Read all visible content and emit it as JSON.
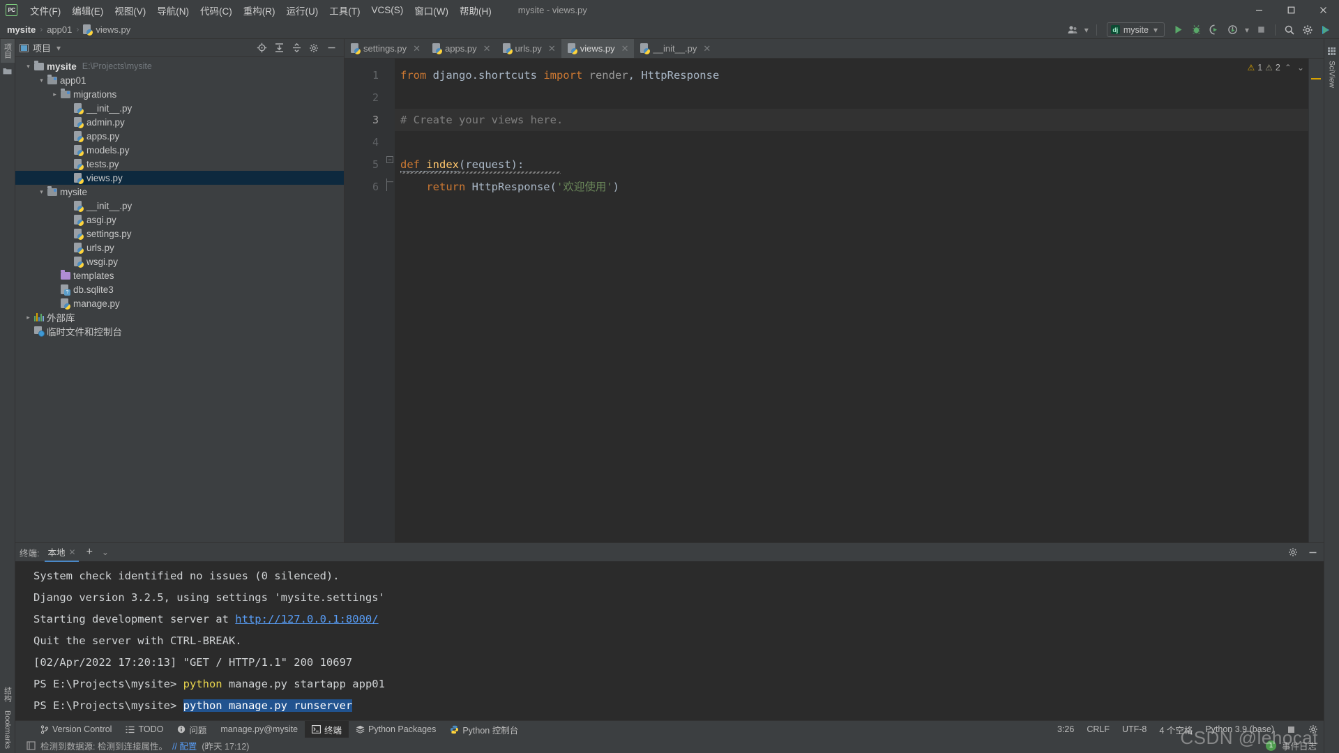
{
  "window": {
    "title": "mysite - views.py",
    "logo_text": "PC",
    "controls": {
      "minimize": "—",
      "maximize": "☐",
      "close": "✕"
    }
  },
  "menubar": {
    "items": [
      {
        "label": "文件(F)"
      },
      {
        "label": "编辑(E)"
      },
      {
        "label": "视图(V)"
      },
      {
        "label": "导航(N)"
      },
      {
        "label": "代码(C)"
      },
      {
        "label": "重构(R)"
      },
      {
        "label": "运行(U)"
      },
      {
        "label": "工具(T)"
      },
      {
        "label": "VCS(S)"
      },
      {
        "label": "窗口(W)"
      },
      {
        "label": "帮助(H)"
      }
    ]
  },
  "breadcrumb": {
    "items": [
      "mysite",
      "app01",
      "views.py"
    ],
    "separator": "›"
  },
  "toolbar": {
    "run_config": {
      "label": "mysite",
      "icon": "django-icon",
      "badge": "dj"
    },
    "buttons": [
      {
        "name": "user-icon",
        "glyph": "user"
      },
      {
        "name": "run-button",
        "glyph": "run"
      },
      {
        "name": "debug-button",
        "glyph": "debug"
      },
      {
        "name": "coverage-button",
        "glyph": "coverage"
      },
      {
        "name": "profile-button",
        "glyph": "profile"
      },
      {
        "name": "stop-button",
        "glyph": "stop"
      },
      {
        "name": "search-everywhere-button",
        "glyph": "search"
      },
      {
        "name": "settings-button",
        "glyph": "gear"
      },
      {
        "name": "update-button",
        "glyph": "play-colored"
      }
    ]
  },
  "rails": {
    "left_top": [
      {
        "label": "项目",
        "active": true
      }
    ],
    "left_bottom": [
      {
        "label": "结构"
      },
      {
        "label": "Bookmarks"
      }
    ],
    "right": [
      {
        "label": "SciView"
      }
    ]
  },
  "project_panel": {
    "title": "项目",
    "icons": [
      "locate-icon",
      "expand-all-icon",
      "collapse-all-icon",
      "gear-icon",
      "hide-icon"
    ],
    "tree": [
      {
        "label": "mysite",
        "path": "E:\\Projects\\mysite",
        "kind": "root-folder",
        "indent": 0,
        "arrow": "down",
        "bold": true
      },
      {
        "label": "app01",
        "kind": "source-folder",
        "indent": 1,
        "arrow": "down"
      },
      {
        "label": "migrations",
        "kind": "source-folder",
        "indent": 2,
        "arrow": "right"
      },
      {
        "label": "__init__.py",
        "kind": "python-file",
        "indent": 3
      },
      {
        "label": "admin.py",
        "kind": "python-file",
        "indent": 3
      },
      {
        "label": "apps.py",
        "kind": "python-file",
        "indent": 3
      },
      {
        "label": "models.py",
        "kind": "python-file",
        "indent": 3
      },
      {
        "label": "tests.py",
        "kind": "python-file",
        "indent": 3
      },
      {
        "label": "views.py",
        "kind": "python-file",
        "indent": 3,
        "selected": true
      },
      {
        "label": "mysite",
        "kind": "source-folder",
        "indent": 1,
        "arrow": "down"
      },
      {
        "label": "__init__.py",
        "kind": "python-file",
        "indent": 3
      },
      {
        "label": "asgi.py",
        "kind": "python-file",
        "indent": 3
      },
      {
        "label": "settings.py",
        "kind": "python-file",
        "indent": 3
      },
      {
        "label": "urls.py",
        "kind": "python-file",
        "indent": 3
      },
      {
        "label": "wsgi.py",
        "kind": "python-file",
        "indent": 3
      },
      {
        "label": "templates",
        "kind": "template-folder",
        "indent": 2
      },
      {
        "label": "db.sqlite3",
        "kind": "db-file",
        "indent": 2
      },
      {
        "label": "manage.py",
        "kind": "python-file",
        "indent": 2
      },
      {
        "label": "外部库",
        "kind": "library",
        "indent": 0,
        "arrow": "right"
      },
      {
        "label": "临时文件和控制台",
        "kind": "scratches",
        "indent": 0
      }
    ]
  },
  "editor": {
    "tabs": [
      {
        "label": "settings.py",
        "active": false
      },
      {
        "label": "apps.py",
        "active": false
      },
      {
        "label": "urls.py",
        "active": false
      },
      {
        "label": "views.py",
        "active": true
      },
      {
        "label": "__init__.py",
        "active": false
      }
    ],
    "inspections": {
      "warnings": "1",
      "weak_warnings": "2",
      "up": "⌃",
      "down": "⌄"
    },
    "gutter_lines": [
      "1",
      "2",
      "3",
      "4",
      "5",
      "6"
    ],
    "current_line": 3,
    "code_lines": [
      {
        "n": 1,
        "tokens": [
          {
            "t": "from ",
            "c": "kw"
          },
          {
            "t": "django.shortcuts ",
            "c": "plain"
          },
          {
            "t": "import ",
            "c": "kw"
          },
          {
            "t": "render",
            "c": "dim"
          },
          {
            "t": ", ",
            "c": "plain"
          },
          {
            "t": "HttpResponse",
            "c": "plain"
          }
        ]
      },
      {
        "n": 2,
        "tokens": []
      },
      {
        "n": 3,
        "tokens": [
          {
            "t": "# Create your views here.",
            "c": "cmt"
          }
        ]
      },
      {
        "n": 4,
        "tokens": []
      },
      {
        "n": 5,
        "tokens": [
          {
            "t": "def ",
            "c": "kw"
          },
          {
            "t": "index",
            "c": "fn"
          },
          {
            "t": "(request):",
            "c": "plain"
          }
        ]
      },
      {
        "n": 6,
        "tokens": [
          {
            "t": "    return ",
            "c": "kw"
          },
          {
            "t": "HttpResponse(",
            "c": "plain"
          },
          {
            "t": "'欢迎使用'",
            "c": "str"
          },
          {
            "t": ")",
            "c": "plain"
          }
        ]
      }
    ]
  },
  "terminal": {
    "title": "终端:",
    "tab": "本地",
    "add_label": "+",
    "chevron": "⌄",
    "header_icons": [
      "gear-icon",
      "hide-icon"
    ],
    "lines": [
      {
        "segments": [
          {
            "t": "System check identified no issues (0 silenced).",
            "c": ""
          }
        ]
      },
      {
        "segments": [
          {
            "t": "Django version 3.2.5, using settings 'mysite.settings'",
            "c": ""
          }
        ]
      },
      {
        "segments": [
          {
            "t": "Starting development server at ",
            "c": ""
          },
          {
            "t": "http://127.0.0.1:8000/",
            "c": "tlink"
          }
        ]
      },
      {
        "segments": [
          {
            "t": "Quit the server with CTRL-BREAK.",
            "c": ""
          }
        ]
      },
      {
        "segments": [
          {
            "t": "[02/Apr/2022 17:20:13] \"GET / HTTP/1.1\" 200 10697",
            "c": ""
          }
        ]
      },
      {
        "segments": [
          {
            "t": "PS E:\\Projects\\mysite> ",
            "c": ""
          },
          {
            "t": "python",
            "c": "tyellow"
          },
          {
            "t": " manage.py startapp app01",
            "c": ""
          }
        ]
      },
      {
        "segments": [
          {
            "t": "PS E:\\Projects\\mysite> ",
            "c": ""
          },
          {
            "t": "python manage.py runserver",
            "c": "tsel"
          }
        ]
      }
    ]
  },
  "statusbar": {
    "items": [
      {
        "label": "Version Control",
        "icon": "branch-icon",
        "active": false
      },
      {
        "label": "TODO",
        "icon": "list-icon",
        "active": false
      },
      {
        "label": "问题",
        "icon": "info-icon",
        "active": false
      },
      {
        "label": "manage.py@mysite",
        "icon": "",
        "active": false
      },
      {
        "label": "终端",
        "icon": "terminal-icon",
        "active": true
      },
      {
        "label": "Python Packages",
        "icon": "packages-icon",
        "active": false
      },
      {
        "label": "Python 控制台",
        "icon": "python-icon",
        "active": false
      }
    ],
    "right": [
      {
        "label": "3:26",
        "name": "caret-position"
      },
      {
        "label": "CRLF",
        "name": "line-separator"
      },
      {
        "label": "UTF-8",
        "name": "file-encoding"
      },
      {
        "label": "4 个空格",
        "name": "indent-setting"
      },
      {
        "label": "Python 3.9 (base)",
        "name": "interpreter"
      }
    ]
  },
  "notification": {
    "text": "检测到数据源: 检测到连接属性。",
    "link": "// 配置",
    "time": "(昨天 17:12)",
    "event_log": "事件日志",
    "event_count": "1"
  },
  "watermark": {
    "text": "CSDN @lehocat"
  },
  "colors": {
    "accent_blue": "#4a88c7",
    "selection": "#21538f",
    "tree_selection": "#0d293e",
    "warning": "#d9a300",
    "keyword": "#cc7832",
    "string": "#6a8759",
    "function": "#ffc66d",
    "comment": "#808080",
    "editor_bg": "#2b2b2b",
    "panel_bg": "#3c3f41"
  }
}
